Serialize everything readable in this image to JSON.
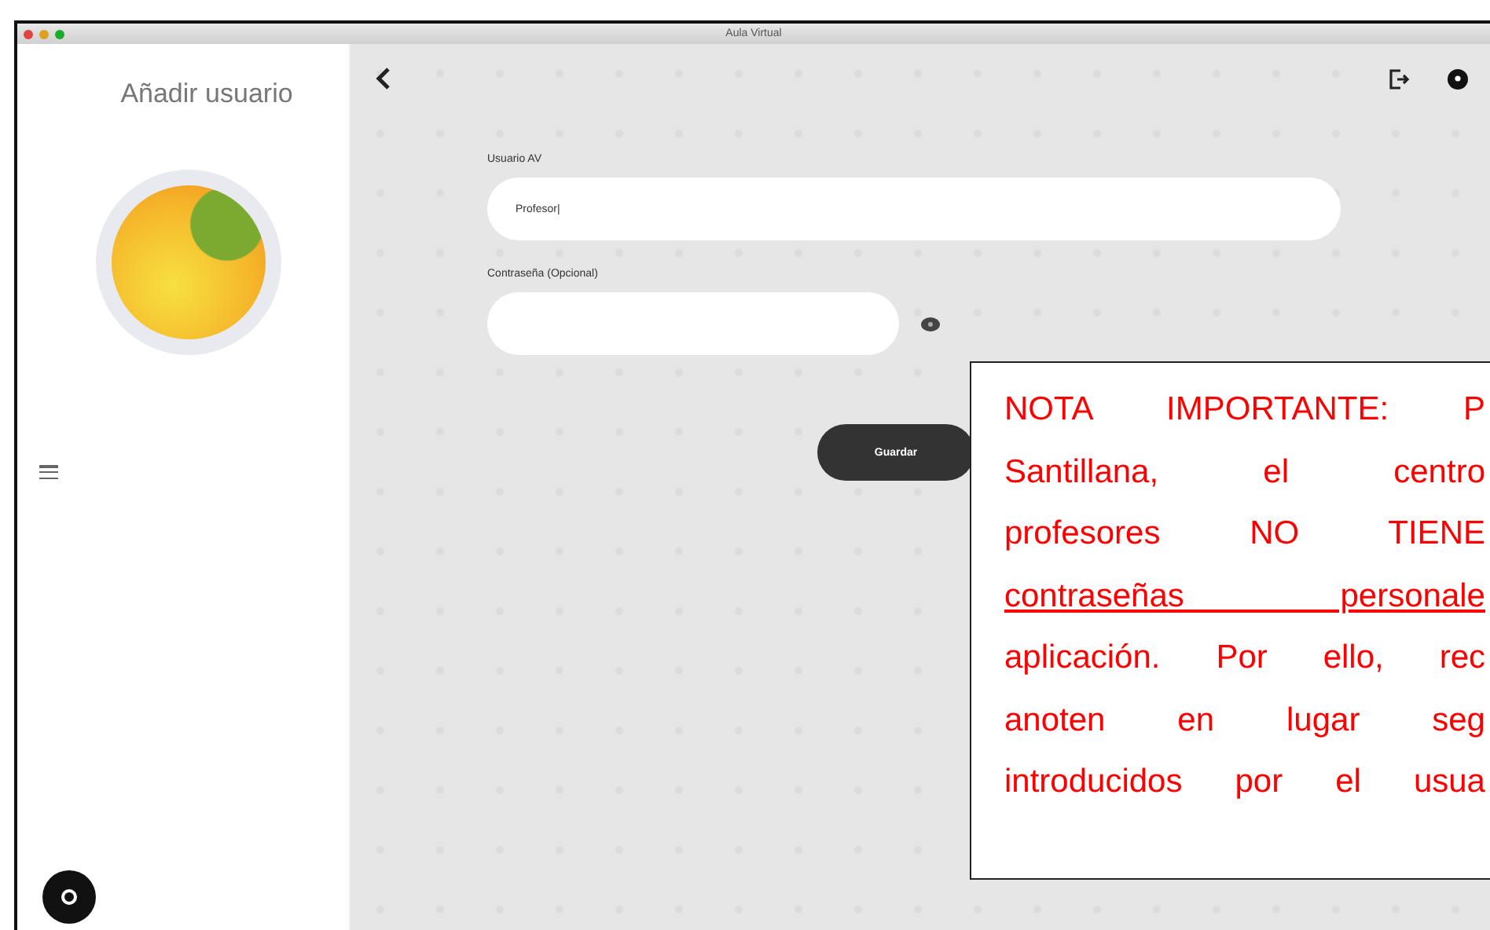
{
  "window": {
    "title": "Aula Virtual"
  },
  "sidebar": {
    "title": "Añadir usuario"
  },
  "form": {
    "fields": [
      {
        "label": "Usuario AV",
        "value": "Profesor|",
        "kind": "text"
      },
      {
        "label": "Contraseña (Opcional)",
        "kind": "password"
      }
    ],
    "save_button": "Guardar"
  },
  "note": {
    "lines": [
      {
        "text": "NOTA IMPORTANTE: P",
        "underlined": false
      },
      {
        "text": "Santillana, el centro",
        "underlined": false
      },
      {
        "text": "profesores NO TIENE",
        "underlined": false
      },
      {
        "text": "contraseñas personale",
        "underlined": true
      },
      {
        "text": "aplicación. Por ello, rec",
        "underlined": false
      },
      {
        "text": "anoten en lugar seg",
        "underlined": false
      },
      {
        "text": "introducidos por el usua",
        "underlined": false
      }
    ]
  }
}
